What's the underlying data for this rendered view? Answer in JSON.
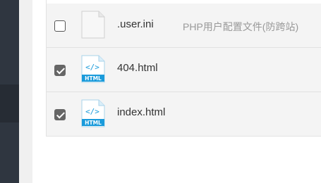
{
  "files": [
    {
      "name": ".user.ini",
      "description": "PHP用户配置文件(防跨站)",
      "checked": false,
      "icon": "blank-file-icon"
    },
    {
      "name": "404.html",
      "description": "",
      "checked": true,
      "icon": "html-file-icon",
      "badge": "HTML"
    },
    {
      "name": "index.html",
      "description": "",
      "checked": true,
      "icon": "html-file-icon",
      "badge": "HTML"
    }
  ],
  "colors": {
    "sidebar": "#2f3640",
    "row_bg": "#f4f4f4",
    "html_badge": "#1a9bdb",
    "checkbox_checked": "#666666"
  }
}
